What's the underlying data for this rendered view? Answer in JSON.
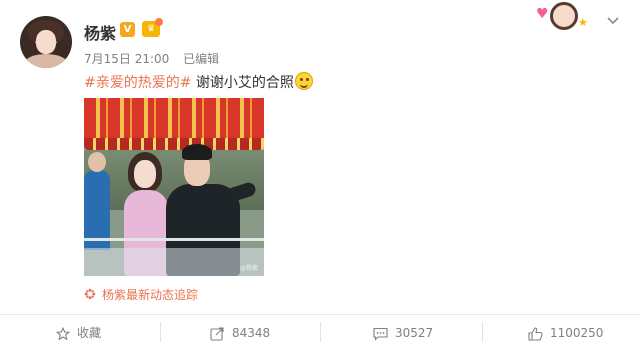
{
  "post": {
    "author": "杨紫",
    "verified_mark": "V",
    "date": "7月15日 21:00",
    "edited": "已编辑",
    "hashtag": "#亲爱的热爱的#",
    "text": " 谢谢小艾的合照",
    "emoji": "smile-icon",
    "photo_watermark": "@杨紫",
    "tracker": "杨紫最新动态追踪"
  },
  "actions": {
    "favorite": "收藏",
    "repost": "84348",
    "comment": "30527",
    "like": "1100250"
  },
  "colors": {
    "hashtag": "#eb7350",
    "meta": "#808080",
    "verified": "#f5a623"
  }
}
